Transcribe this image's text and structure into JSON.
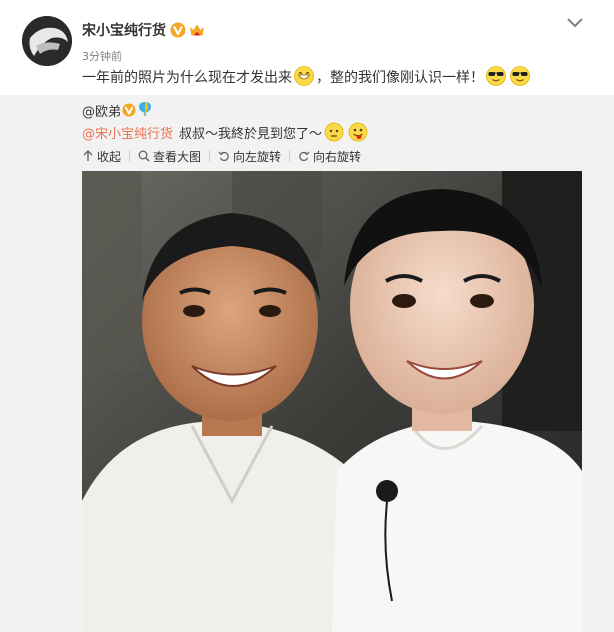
{
  "post": {
    "username": "宋小宝纯行货",
    "time": "3分钟前",
    "text": "一年前的照片为什么现在才发出来",
    "text_tail": "，整的我们像刚认识一样！"
  },
  "repost": {
    "username": "@欧弟",
    "comment_mention": "@宋小宝纯行货",
    "comment_text": "叔叔～我終於見到您了～"
  },
  "actions": {
    "collect": "收起",
    "view_large": "查看大图",
    "rotate_left": "向左旋转",
    "rotate_right": "向右旋转"
  },
  "colors": {
    "mention": "#eb7350",
    "verified": "#f5a623",
    "repost_bg": "#f2f2f2"
  }
}
